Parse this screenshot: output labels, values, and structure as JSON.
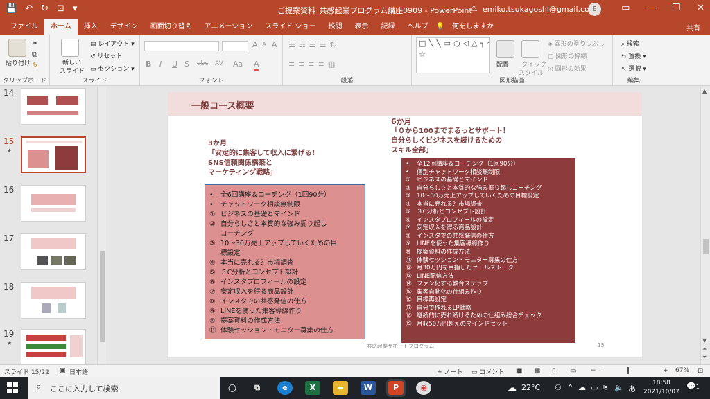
{
  "titlebar": {
    "qat": {
      "save": "💾",
      "undo": "↶",
      "redo": "↻",
      "present": "⊡",
      "more": "▾"
    },
    "document_title": "ご提案資料_共感起業プログラム講座0909  -  PowerPoint",
    "warning_icon": "⚠",
    "account_email": "emiko.tsukagoshi@gmail.com",
    "avatar_initial": "E",
    "window_buttons": {
      "ribbon": "▭",
      "minimize": "—",
      "restore": "❐",
      "close": "✕"
    }
  },
  "tabs": [
    "ファイル",
    "ホーム",
    "挿入",
    "デザイン",
    "画面切り替え",
    "アニメーション",
    "スライド ショー",
    "校閲",
    "表示",
    "記録",
    "ヘルプ",
    "💡",
    "何をしますか"
  ],
  "active_tab": "ホーム",
  "share_label": "共有",
  "ribbon": {
    "clipboard": {
      "label": "クリップボード",
      "paste": "貼り付け"
    },
    "slides": {
      "label": "スライド",
      "new_slide": "新しい",
      "new_slide2": "スライド",
      "layout": "レイアウト",
      "reset": "リセット",
      "section": "セクション"
    },
    "font": {
      "label": "フォント",
      "grow": "A",
      "shrink": "A",
      "clear": "A",
      "bold": "B",
      "italic": "I",
      "underline": "U",
      "shadow": "S",
      "strike": "abc",
      "spacing": "AV",
      "case": "Aa",
      "color": "A"
    },
    "paragraph": {
      "label": "段落"
    },
    "drawing": {
      "label": "図形描画",
      "arrange": "配置",
      "quick_styles": "クイック",
      "quick_styles2": "スタイル",
      "fill": "図形の塗りつぶし",
      "outline": "図形の枠線",
      "effects": "図形の効果"
    },
    "editing": {
      "label": "編集",
      "find": "検索",
      "replace": "置換",
      "select": "選択"
    }
  },
  "thumbnails": [
    {
      "num": "14",
      "star": false
    },
    {
      "num": "15",
      "star": true
    },
    {
      "num": "16",
      "star": false
    },
    {
      "num": "17",
      "star": false
    },
    {
      "num": "18",
      "star": false
    },
    {
      "num": "19",
      "star": true
    }
  ],
  "slide": {
    "title": "一般コース概要",
    "course3": {
      "heading": [
        "3か月",
        "「安定的に集客して収入に繋げる！",
        "SNS信頼関係構築と",
        "マーケティング戦略」"
      ],
      "items": [
        {
          "m": "•",
          "t": "全6回講座＆コーチング（1回90分）"
        },
        {
          "m": "•",
          "t": "チャットワーク相談無制限"
        },
        {
          "m": "①",
          "t": "ビジネスの基礎とマインド"
        },
        {
          "m": "②",
          "t": "自分らしさと本質的な強み掘り起し"
        },
        {
          "m": "",
          "t": "コーチング"
        },
        {
          "m": "③",
          "t": "10〜30万売上アップしていくための目"
        },
        {
          "m": "",
          "t": "標設定"
        },
        {
          "m": "④",
          "t": "本当に売れる？市場調査"
        },
        {
          "m": "⑤",
          "t": "３C分析とコンセプト設計"
        },
        {
          "m": "⑥",
          "t": "インスタプロフィールの設定"
        },
        {
          "m": "⑦",
          "t": "安定収入を得る商品設計"
        },
        {
          "m": "⑧",
          "t": "インスタでの共感発信の仕方"
        },
        {
          "m": "⑨",
          "t": "LINEを使った集客導線作り"
        },
        {
          "m": "⑩",
          "t": "提案資料の作成方法"
        },
        {
          "m": "⑪",
          "t": "体験セッション・モニター募集の仕方"
        }
      ]
    },
    "course6": {
      "heading": [
        "6か月",
        "「０から100までまるっとサポート！",
        "自分らしくビジネスを続けるための",
        "スキル全部」"
      ],
      "items": [
        {
          "m": "•",
          "t": "全12回講座＆コーチング（1回90分）"
        },
        {
          "m": "•",
          "t": "個別チャットワーク相談無制限"
        },
        {
          "m": "①",
          "t": "ビジネスの基礎とマインド"
        },
        {
          "m": "②",
          "t": "自分らしさと本質的な強み掘り起しコーチング"
        },
        {
          "m": "③",
          "t": "10〜30万売上アップしていくための目標設定"
        },
        {
          "m": "④",
          "t": "本当に売れる？市場調査"
        },
        {
          "m": "⑤",
          "t": "３C分析とコンセプト設計"
        },
        {
          "m": "⑥",
          "t": "インスタプロフィールの設定"
        },
        {
          "m": "⑦",
          "t": "安定収入を得る商品設計"
        },
        {
          "m": "⑧",
          "t": "インスタでの共感発信の仕方"
        },
        {
          "m": "⑨",
          "t": "LINEを使った集客導線作り"
        },
        {
          "m": "⑩",
          "t": "提案資料の作成方法"
        },
        {
          "m": "⑪",
          "t": "体験セッション・モニター募集の仕方"
        },
        {
          "m": "⑫",
          "t": "月30万円を目指したセールストーク"
        },
        {
          "m": "⑬",
          "t": "LINE配信方法"
        },
        {
          "m": "⑭",
          "t": "ファン化する教育ステップ"
        },
        {
          "m": "⑮",
          "t": "集客自動化の仕組み作り"
        },
        {
          "m": "⑯",
          "t": "目標再設定"
        },
        {
          "m": "⑰",
          "t": "自分で作れるLP戦略"
        },
        {
          "m": "⑱",
          "t": "継続的に売れ続けるための仕組み総合チェック"
        },
        {
          "m": "⑲",
          "t": "月収50万円超えのマインドセット"
        }
      ]
    },
    "footer": "共感起業サポートプログラム",
    "page_number": "15"
  },
  "statusbar": {
    "slide_info": "スライド 15/22",
    "language": "日本語",
    "notes": "ノート",
    "comments": "コメント",
    "zoom": "67%"
  },
  "taskbar": {
    "search_placeholder": "ここに入力して検索",
    "weather": "22°C",
    "ime": "あ",
    "time": "18:58",
    "date": "2021/10/07",
    "notification_count": "1"
  },
  "colors": {
    "accent": "#b7472a",
    "slide_header": "#f2dcdc",
    "box_pink": "#dc9090",
    "box_maroon": "#8e3b3b"
  }
}
